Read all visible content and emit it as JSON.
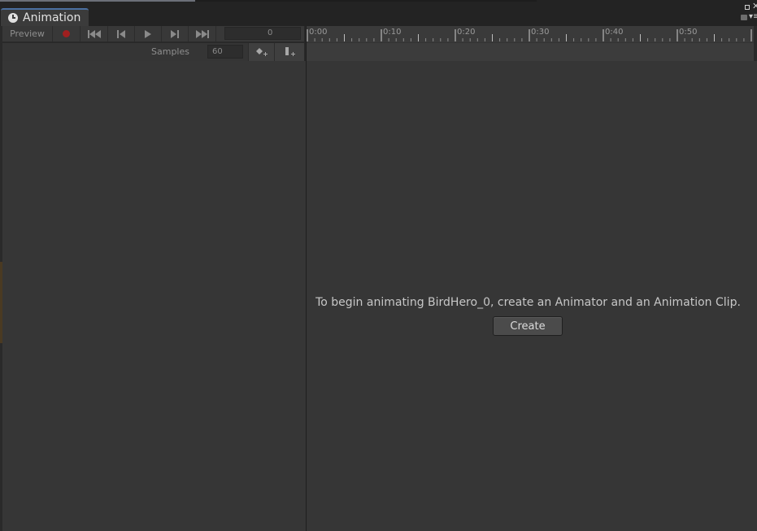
{
  "window": {
    "tab_title": "Animation"
  },
  "toolbar": {
    "preview_label": "Preview",
    "frame_value": "0",
    "samples_label": "Samples",
    "samples_value": "60"
  },
  "timeline": {
    "ruler_labels": [
      "0:00",
      "0:10",
      "0:20",
      "0:30",
      "0:40",
      "0:50"
    ]
  },
  "empty_state": {
    "message": "To begin animating BirdHero_0, create an Animator and an Animation Clip.",
    "create_label": "Create"
  },
  "icons": {
    "tab": "clock-icon",
    "record": "record-icon",
    "first_key": "first-keyframe-icon",
    "prev_key": "previous-keyframe-icon",
    "play": "play-icon",
    "next_key": "next-keyframe-icon",
    "last_key": "last-keyframe-icon",
    "add_keyframe": "add-keyframe-icon",
    "add_event": "add-event-icon",
    "lock": "lock-icon",
    "menu": "menu-icon"
  },
  "colors": {
    "record": "#a01f1f",
    "tab_accent": "#4a6fa0",
    "panel": "#363636"
  }
}
